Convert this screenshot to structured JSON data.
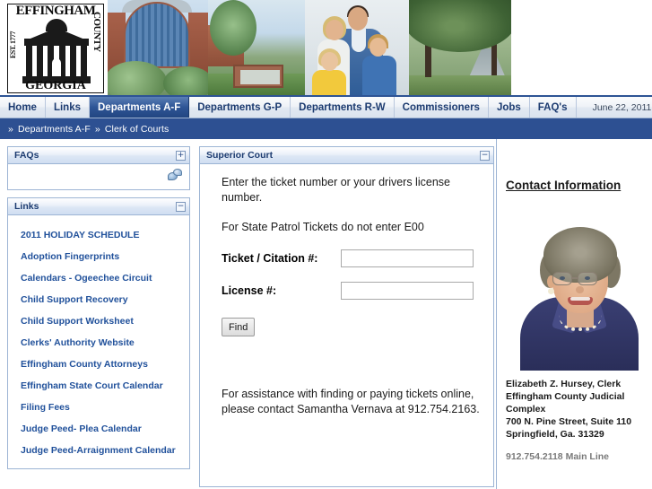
{
  "banner": {
    "seal": {
      "top_text": "EFFINGHAM",
      "right_text": "COUNTY",
      "left_text": "EST. 1777",
      "bottom_text": "GEORGIA"
    }
  },
  "nav": {
    "items": [
      {
        "label": "Home",
        "active": false
      },
      {
        "label": "Links",
        "active": false
      },
      {
        "label": "Departments A-F",
        "active": true
      },
      {
        "label": "Departments G-P",
        "active": false
      },
      {
        "label": "Departments R-W",
        "active": false
      },
      {
        "label": "Commissioners",
        "active": false
      },
      {
        "label": "Jobs",
        "active": false
      },
      {
        "label": "FAQ's",
        "active": false
      }
    ],
    "date": "June 22, 2011"
  },
  "breadcrumb": {
    "marker": "»",
    "level1": "Departments A-F",
    "level2": "Clerk of Courts"
  },
  "sidebar": {
    "faq_panel": {
      "title": "FAQs",
      "toggle": "+"
    },
    "links_panel": {
      "title": "Links",
      "toggle": "−",
      "items": [
        {
          "label": "2011 HOLIDAY SCHEDULE"
        },
        {
          "label": "Adoption Fingerprints"
        },
        {
          "label": "Calendars - Ogeechee Circuit"
        },
        {
          "label": "Child Support Recovery"
        },
        {
          "label": "Child Support Worksheet"
        },
        {
          "label": "Clerks' Authority Website"
        },
        {
          "label": "Effingham County Attorneys"
        },
        {
          "label": "Effingham State Court Calendar"
        },
        {
          "label": "Filing Fees"
        },
        {
          "label": "Judge Peed- Plea Calendar"
        },
        {
          "label": "Judge Peed-Arraignment Calendar"
        }
      ]
    }
  },
  "main": {
    "panel_title": "Superior Court",
    "panel_toggle": "−",
    "intro_line1": "Enter the ticket number or your drivers license number.",
    "intro_line2": "For State Patrol Tickets do not enter E00",
    "form": {
      "ticket_label": "Ticket / Citation #:",
      "ticket_value": "",
      "license_label": "License #:",
      "license_value": "",
      "find_label": "Find"
    },
    "assistance_text": "For assistance with finding or paying tickets online, please contact Samantha Vernava at 912.754.2163."
  },
  "contact": {
    "heading": "Contact Information",
    "lines": [
      "Elizabeth Z. Hursey, Clerk",
      "Effingham County Judicial",
      "Complex",
      "700 N. Pine Street, Suite 110",
      "Springfield, Ga.  31329"
    ],
    "phone": "912.754.2118 Main Line"
  }
}
